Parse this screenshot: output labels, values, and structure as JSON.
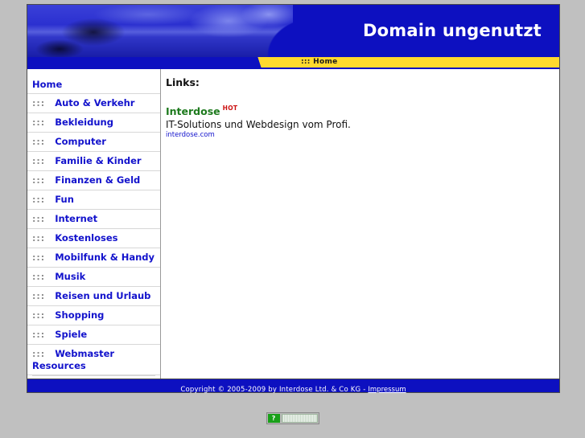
{
  "header": {
    "title": "Domain ungenutzt",
    "photo_alt": "office-desk-photo"
  },
  "navstrip": {
    "label": "::: Home"
  },
  "sidebar": {
    "dots": ":::",
    "items": [
      {
        "label": "Home",
        "has_dots": false
      },
      {
        "label": "Auto & Verkehr",
        "has_dots": true
      },
      {
        "label": "Bekleidung",
        "has_dots": true
      },
      {
        "label": "Computer",
        "has_dots": true
      },
      {
        "label": "Familie & Kinder",
        "has_dots": true
      },
      {
        "label": "Finanzen & Geld",
        "has_dots": true
      },
      {
        "label": "Fun",
        "has_dots": true
      },
      {
        "label": "Internet",
        "has_dots": true
      },
      {
        "label": "Kostenloses",
        "has_dots": true
      },
      {
        "label": "Mobilfunk & Handy",
        "has_dots": true
      },
      {
        "label": "Musik",
        "has_dots": true
      },
      {
        "label": "Reisen und Urlaub",
        "has_dots": true
      },
      {
        "label": "Shopping",
        "has_dots": true
      },
      {
        "label": "Spiele",
        "has_dots": true
      },
      {
        "label": "Webmaster Resources",
        "has_dots": true
      }
    ]
  },
  "content": {
    "heading": "Links:",
    "links": [
      {
        "title": "Interdose",
        "badge": "HOT",
        "description": "IT-Solutions und Webdesign vom Profi.",
        "url": "interdose.com"
      }
    ]
  },
  "footer": {
    "copyright": "Copyright © 2005-2009 by Interdose Ltd. & Co KG - ",
    "link_label": "Impressum"
  },
  "badge": {
    "icon_glyph": "?",
    "bar_label": ""
  },
  "colors": {
    "brand_blue": "#0d10c0",
    "accent_yellow": "#ffd92e",
    "link_blue": "#1212cc",
    "title_green": "#1d7a1d",
    "hot_red": "#cc1111",
    "page_background": "#c0c0c0"
  }
}
